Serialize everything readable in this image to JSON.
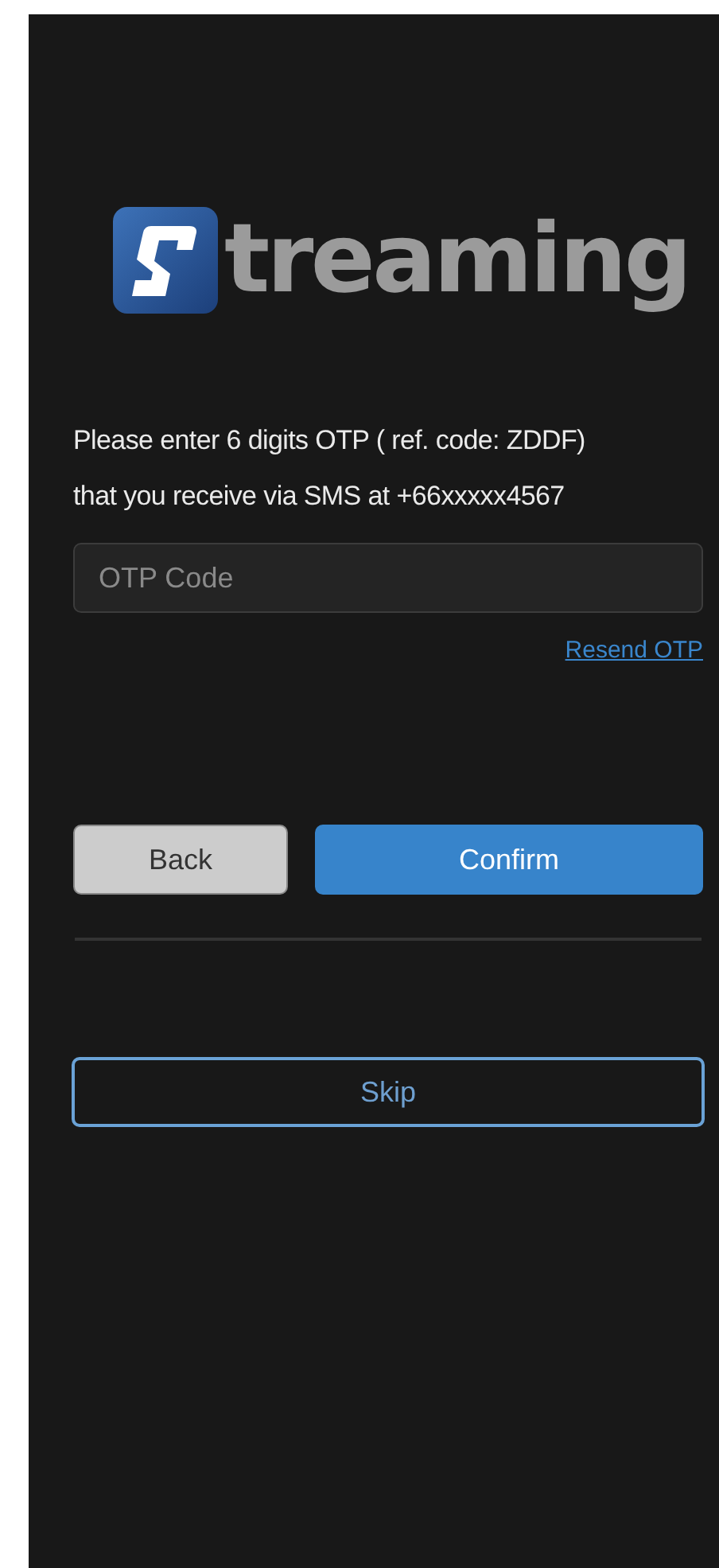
{
  "logo": {
    "wordmark": "treaming"
  },
  "instructions": [
    "Please enter 6 digits OTP ( ref. code: ZDDF)",
    "that you receive via SMS at +66xxxxx4567"
  ],
  "otp_field": {
    "placeholder": "OTP Code"
  },
  "resend_link": "Resend OTP",
  "buttons": [
    {
      "kind": "secondary",
      "label": "Back"
    },
    {
      "kind": "primary",
      "label": "Confirm"
    }
  ],
  "skip_button": {
    "label": "Skip"
  }
}
